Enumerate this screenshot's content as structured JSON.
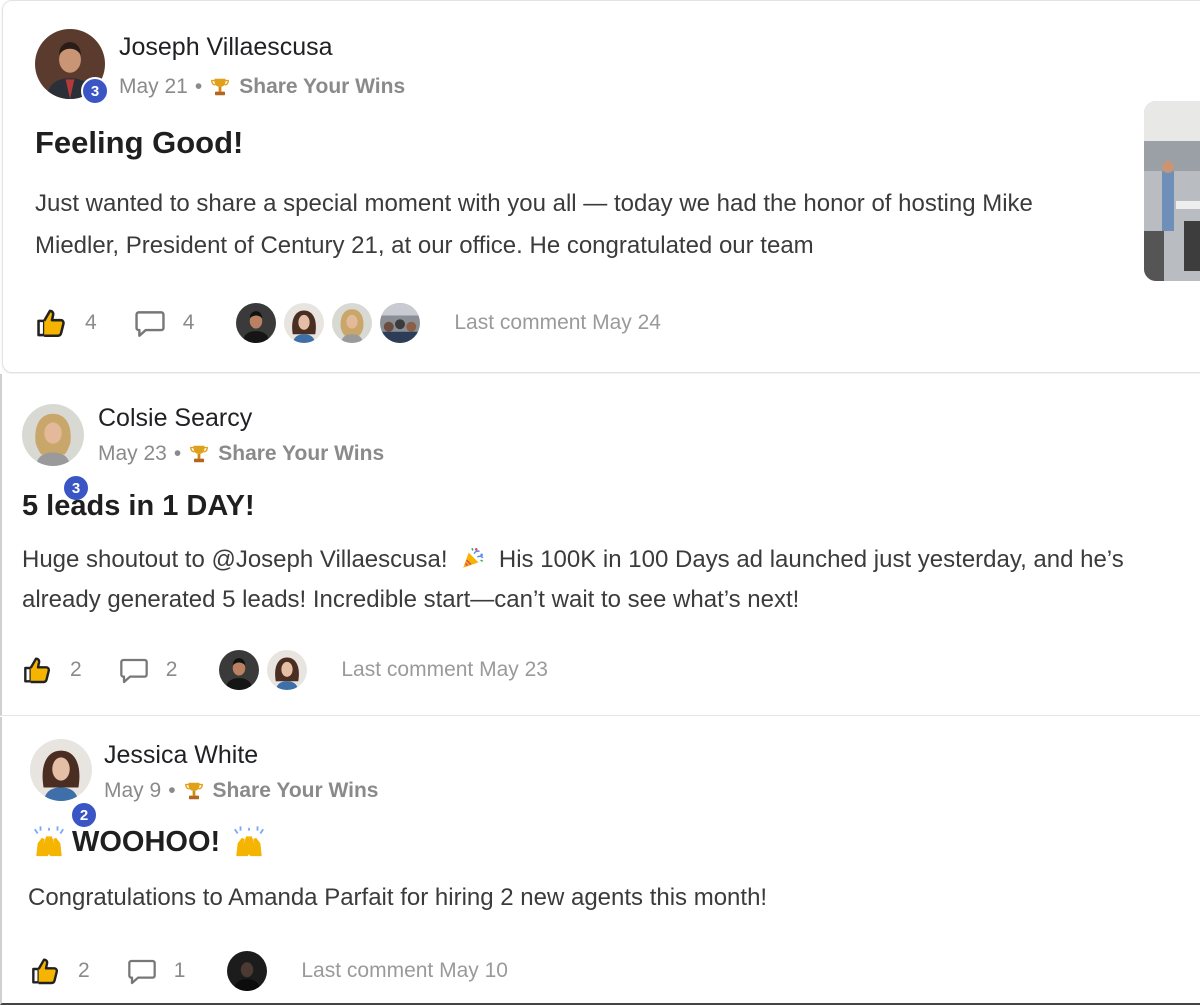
{
  "posts": [
    {
      "author": "Joseph Villaescusa",
      "level": "3",
      "date": "May 21",
      "separator": "•",
      "category": "Share Your Wins",
      "title": "Feeling Good!",
      "body": "Just wanted to share a special moment with you all — today we had the honor of hosting Mike Miedler, President of Century 21, at our office. He congratulated our team",
      "likes": "4",
      "comments": "4",
      "last_comment": "Last comment May 24"
    },
    {
      "author": "Colsie Searcy",
      "level": "3",
      "date": "May 23",
      "separator": "•",
      "category": "Share Your Wins",
      "title": "5 leads in 1 DAY!",
      "body_before_emoji": "Huge shoutout to @Joseph Villaescusa!",
      "body_after_emoji": "His 100K in 100 Days ad launched just yesterday, and he’s already generated 5 leads! Incredible start—can’t wait to see what’s next!",
      "likes": "2",
      "comments": "2",
      "last_comment": "Last comment May 23"
    },
    {
      "author": "Jessica White",
      "level": "2",
      "date": "May 9",
      "separator": "•",
      "category": "Share Your Wins",
      "title": "WOOHOO!",
      "body": "Congratulations to Amanda Parfait for hiring 2 new agents this month!",
      "likes": "2",
      "comments": "1",
      "last_comment": "Last comment May 10"
    }
  ],
  "icons": {
    "like": "thumbs-up-icon",
    "comment": "comment-bubble-icon",
    "category": "trophy-icon",
    "celebrate": "party-popper-icon",
    "raised_hands": "raising-hands-icon"
  },
  "colors": {
    "level_badge": "#3a56c5",
    "trophy": "#e0a01a",
    "muted_text": "#8a8a8a"
  }
}
